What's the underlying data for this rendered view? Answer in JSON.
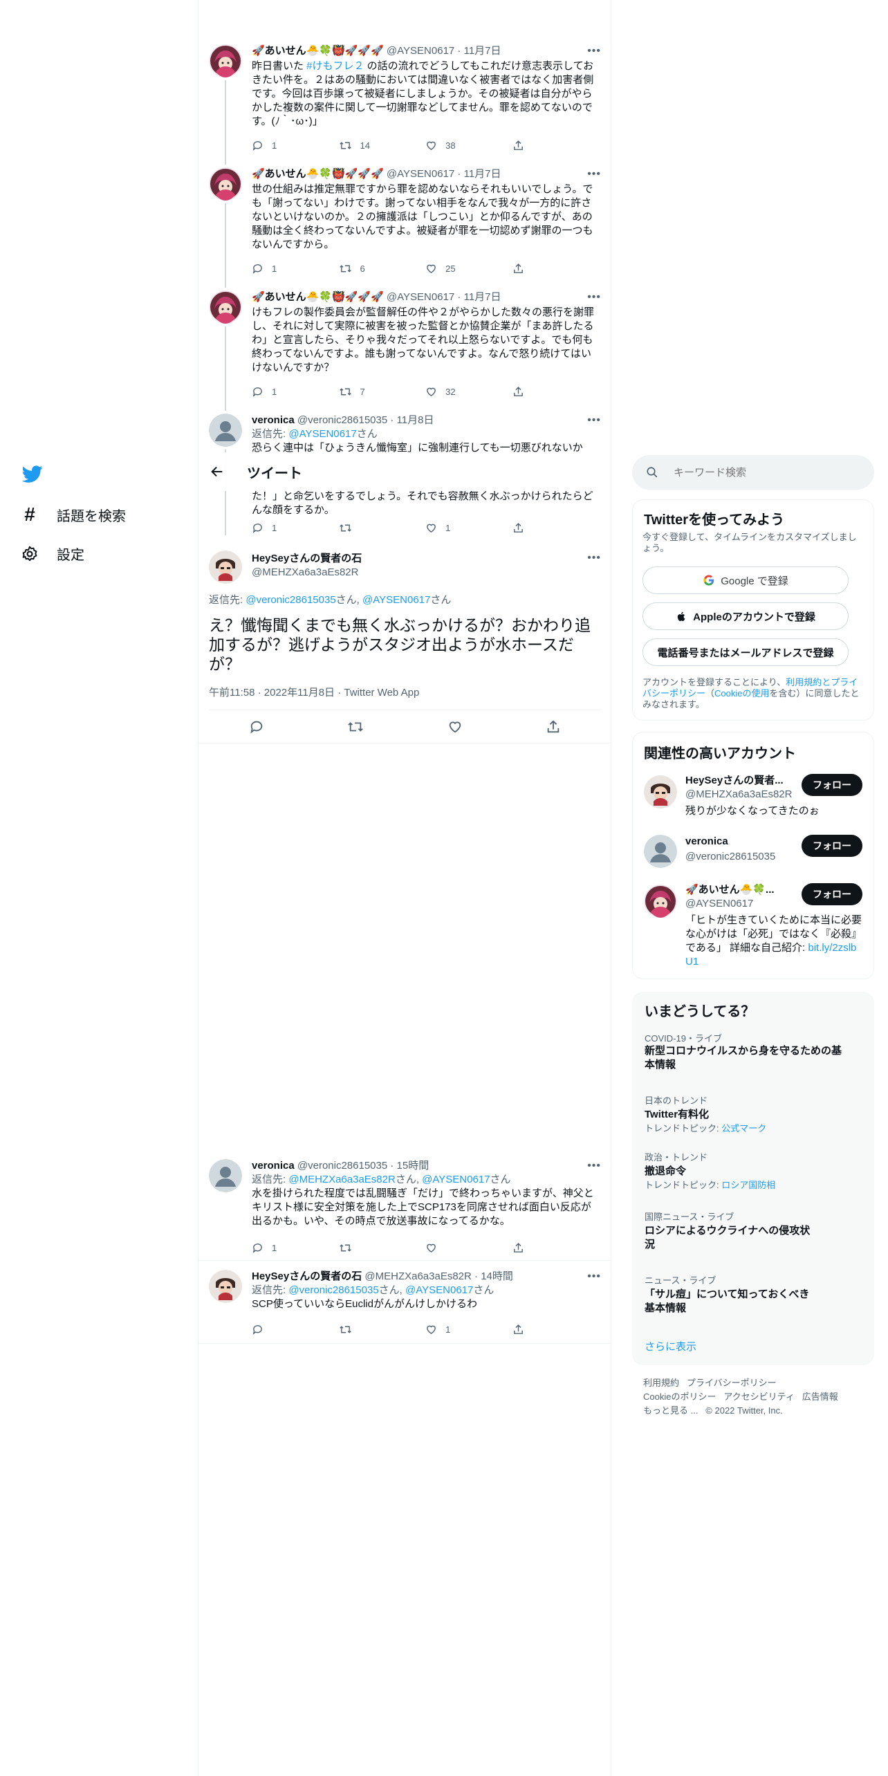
{
  "nav": {
    "explore": "話題を検索",
    "settings": "設定"
  },
  "header": {
    "title": "ツイート"
  },
  "thread": [
    {
      "name": "🚀あいせん🐣🍀👹🚀🚀🚀",
      "handle": "@AYSEN0617",
      "date": "11月7日",
      "text_before": "昨日書いた ",
      "hashtag": "#けもフレ２",
      "text_after": " の話の流れでどうしてもこれだけ意志表示しておきたい件を。２はあの騒動においては間違いなく被害者ではなく加害者側です。今回は百歩譲って被疑者にしましょうか。その被疑者は自分がやらかした複数の案件に関して一切謝罪などしてません。罪を認めてないのです。(ﾉ｀･ω･)｣",
      "replies": "1",
      "retweets": "14",
      "likes": "38"
    },
    {
      "name": "🚀あいせん🐣🍀👹🚀🚀🚀",
      "handle": "@AYSEN0617",
      "date": "11月7日",
      "text": "世の仕組みは推定無罪ですから罪を認めないならそれもいいでしょう。でも「謝ってない」わけです。謝ってない相手をなんで我々が一方的に許さないといけないのか。２の擁護派は「しつこい」とか仰るんですが、あの騒動は全く終わってないんですよ。被疑者が罪を一切認めず謝罪の一つもないんですから。",
      "replies": "1",
      "retweets": "6",
      "likes": "25"
    },
    {
      "name": "🚀あいせん🐣🍀👹🚀🚀🚀",
      "handle": "@AYSEN0617",
      "date": "11月7日",
      "text": "けもフレの製作委員会が監督解任の件や２がやらかした数々の悪行を謝罪し、それに対して実際に被害を被った監督とか協賛企業が「まあ許したるわ」と宣言したら、そりゃ我々だってそれ以上怒らないですよ。でも何も終わってないんですよ。誰も謝ってないんですよ。なんで怒り続けてはいけないんですか？",
      "replies": "1",
      "retweets": "7",
      "likes": "32"
    },
    {
      "name": "veronica",
      "handle": "@veronic28615035",
      "date": "11月8日",
      "reply_label": "返信先: ",
      "reply_to": "@AYSEN0617",
      "reply_suffix": "さん",
      "text_top": "恐らく連中は「ひょうきん懺悔室」に強制連行しても一切悪びれないか",
      "text_bottom": "た！」と命乞いをするでしょう。それでも容赦無く水ぶっかけられたらどんな顔をするか。",
      "replies": "1",
      "retweets": "",
      "likes": "1"
    }
  ],
  "main_tweet": {
    "name": "HeySeyさんの賢者の石",
    "handle": "@MEHZXa6a3aEs82R",
    "reply_label": "返信先: ",
    "reply_to_1": "@veronic28615035",
    "mid": "さん, ",
    "reply_to_2": "@AYSEN0617",
    "reply_suffix": "さん",
    "text": "え？懺悔聞くまでも無く水ぶっかけるが？おかわり追加するが？逃げようがスタジオ出ようが水ホースだが？",
    "timestamp": "午前11:58 · 2022年11月8日 · Twitter Web App"
  },
  "replies": [
    {
      "name": "veronica",
      "handle": "@veronic28615035",
      "date": "15時間",
      "reply_label": "返信先: ",
      "reply_to_1": "@MEHZXa6a3aEs82R",
      "mid": "さん, ",
      "reply_to_2": "@AYSEN0617",
      "reply_suffix": "さん",
      "text": "水を掛けられた程度では乱闘騒ぎ「だけ」で終わっちゃいますが、神父とキリスト様に安全対策を施した上でSCP173を同席させれば面白い反応が出るかも。いや、その時点で放送事故になってるかな。",
      "replies": "1",
      "retweets": "",
      "likes": ""
    },
    {
      "name": "HeySeyさんの賢者の石",
      "handle": "@MEHZXa6a3aEs82R",
      "date": "14時間",
      "reply_label": "返信先: ",
      "reply_to_1": "@veronic28615035",
      "mid": "さん, ",
      "reply_to_2": "@AYSEN0617",
      "reply_suffix": "さん",
      "text": "SCP使っていいならEuclidがんがんけしかけるわ",
      "replies": "",
      "retweets": "",
      "likes": "1"
    }
  ],
  "search": {
    "placeholder": "キーワード検索"
  },
  "signup": {
    "title": "Twitterを使ってみよう",
    "subtitle": "今すぐ登録して、タイムラインをカスタマイズしましょう。",
    "google": "Google で登録",
    "apple": "Appleのアカウントで登録",
    "phone": "電話番号またはメールアドレスで登録",
    "legal_1": "アカウントを登録することにより、",
    "legal_link1": "利用規約とプライバシーポリシー",
    "legal_2": "（",
    "legal_link2": "Cookieの使用",
    "legal_3": "を含む）に同意したとみなされます。"
  },
  "related": {
    "title": "関連性の高いアカウント",
    "follow": "フォロー",
    "accounts": [
      {
        "name": "HeySeyさんの賢者...",
        "handle": "@MEHZXa6a3aEs82R",
        "bio": "残りが少なくなってきたのぉ"
      },
      {
        "name": "veronica",
        "handle": "@veronic28615035",
        "bio": ""
      },
      {
        "name": "🚀あいせん🐣🍀...",
        "handle": "@AYSEN0617",
        "bio": "「ヒトが生きていくために本当に必要な心がけは「必死」ではなく『必殺』である」 詳細な自己紹介: ",
        "bio_link": "bit.ly/2zslbU1"
      }
    ]
  },
  "trends": {
    "title": "いまどうしてる？",
    "items": [
      {
        "meta": "COVID-19・ライブ",
        "title": "新型コロナウイルスから身を守るための基本情報",
        "sub": "",
        "sub_link": ""
      },
      {
        "meta": "日本のトレンド",
        "title": "Twitter有料化",
        "sub": "トレンドトピック: ",
        "sub_link": "公式マーク"
      },
      {
        "meta": "政治・トレンド",
        "title": "撤退命令",
        "sub": "トレンドトピック: ",
        "sub_link": "ロシア国防相"
      },
      {
        "meta": "国際ニュース・ライブ",
        "title": "ロシアによるウクライナへの侵攻状況",
        "sub": "",
        "sub_link": ""
      },
      {
        "meta": "ニュース・ライブ",
        "title": "「サル痘」について知っておくべき基本情報",
        "sub": "",
        "sub_link": ""
      }
    ],
    "more": "さらに表示"
  },
  "footer": {
    "terms": "利用規約",
    "privacy": "プライバシーポリシー",
    "cookie": "Cookieのポリシー",
    "access": "アクセシビリティ",
    "ads": "広告情報",
    "more": "もっと見る ...",
    "copyright": "© 2022 Twitter, Inc."
  },
  "colors": {
    "brand": "#1d9bf0",
    "text": "#0f1419",
    "muted": "#536471"
  }
}
